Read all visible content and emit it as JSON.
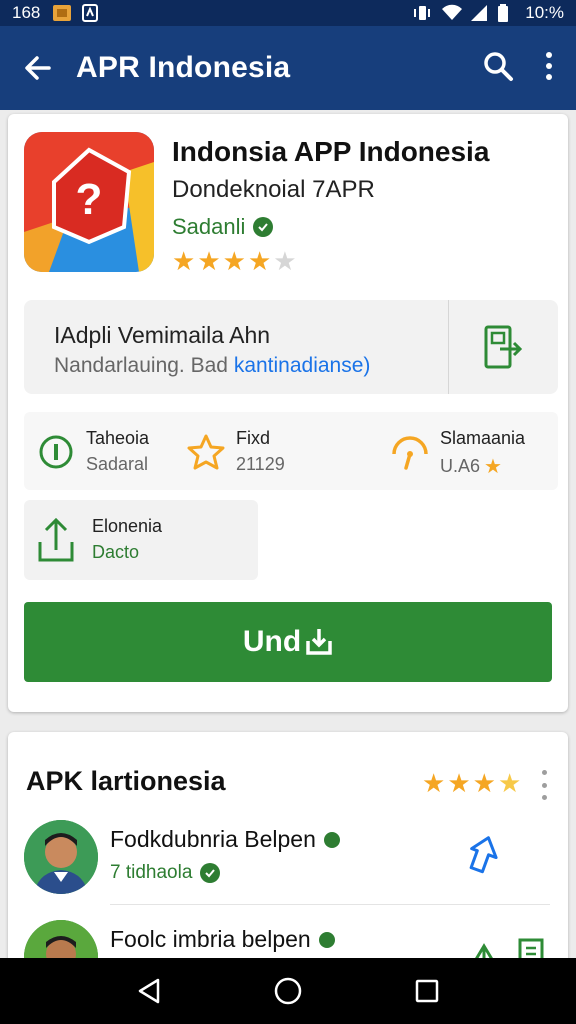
{
  "status_bar": {
    "time_left": "168",
    "battery": "10:%"
  },
  "app_bar": {
    "title": "APR Indonesia",
    "back_icon": "arrow-back-icon",
    "search_icon": "search-icon",
    "more_icon": "more-vert-icon"
  },
  "app": {
    "name": "Indonsia APP Indonesia",
    "developer": "Dondeknoial 7APR",
    "publisher": "Sadanli",
    "rating_stars": 3.5,
    "rating_max": 5
  },
  "info_box": {
    "title": "IAdpli Vemimaila Ahn",
    "subtitle": "Nandarlauing. Bad",
    "link": "kantinadianse)"
  },
  "stats": [
    {
      "label": "Taheoia",
      "value": "Sadaral",
      "icon": "info-circle-icon"
    },
    {
      "label": "Fixd",
      "value": "21129",
      "icon": "star-badge-icon"
    },
    {
      "label": "Slamaania",
      "value": "U.A6",
      "icon": "rating-icon"
    }
  ],
  "update": {
    "label": "Elonenia",
    "value": "Dacto"
  },
  "install_button": {
    "label": "Und"
  },
  "section": {
    "title": "APK lartionesia",
    "rating_stars": 4,
    "items": [
      {
        "name": "Fodkdubnria Belpen",
        "sub": "7 tidhaola"
      },
      {
        "name": "Foolc imbria belpen",
        "sub": ""
      }
    ]
  },
  "colors": {
    "app_bar": "#173e7c",
    "status_bar": "#0d2a5c",
    "install": "#2e8b36",
    "accent_green": "#2e7d32",
    "link_blue": "#1a73e8",
    "star": "#f5a623"
  }
}
